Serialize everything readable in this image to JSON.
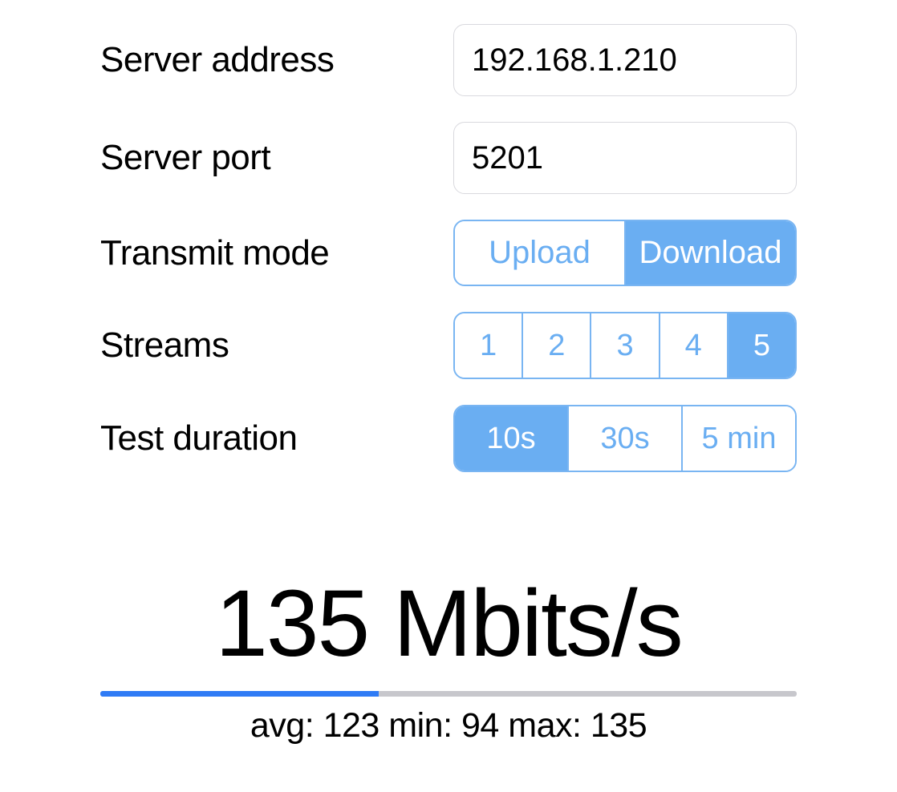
{
  "form": {
    "server_address": {
      "label": "Server address",
      "value": "192.168.1.210"
    },
    "server_port": {
      "label": "Server port",
      "value": "5201"
    },
    "transmit_mode": {
      "label": "Transmit mode",
      "options": [
        "Upload",
        "Download"
      ],
      "selected": 1
    },
    "streams": {
      "label": "Streams",
      "options": [
        "1",
        "2",
        "3",
        "4",
        "5"
      ],
      "selected": 4
    },
    "test_duration": {
      "label": "Test duration",
      "options": [
        "10s",
        "30s",
        "5 min"
      ],
      "selected": 0
    }
  },
  "result": {
    "speed_value": "135",
    "speed_unit": "Mbits/s",
    "progress_percent": 40,
    "stats": {
      "avg": "123",
      "min": "94",
      "max": "135"
    },
    "stats_text": "avg: 123 min: 94 max: 135"
  }
}
